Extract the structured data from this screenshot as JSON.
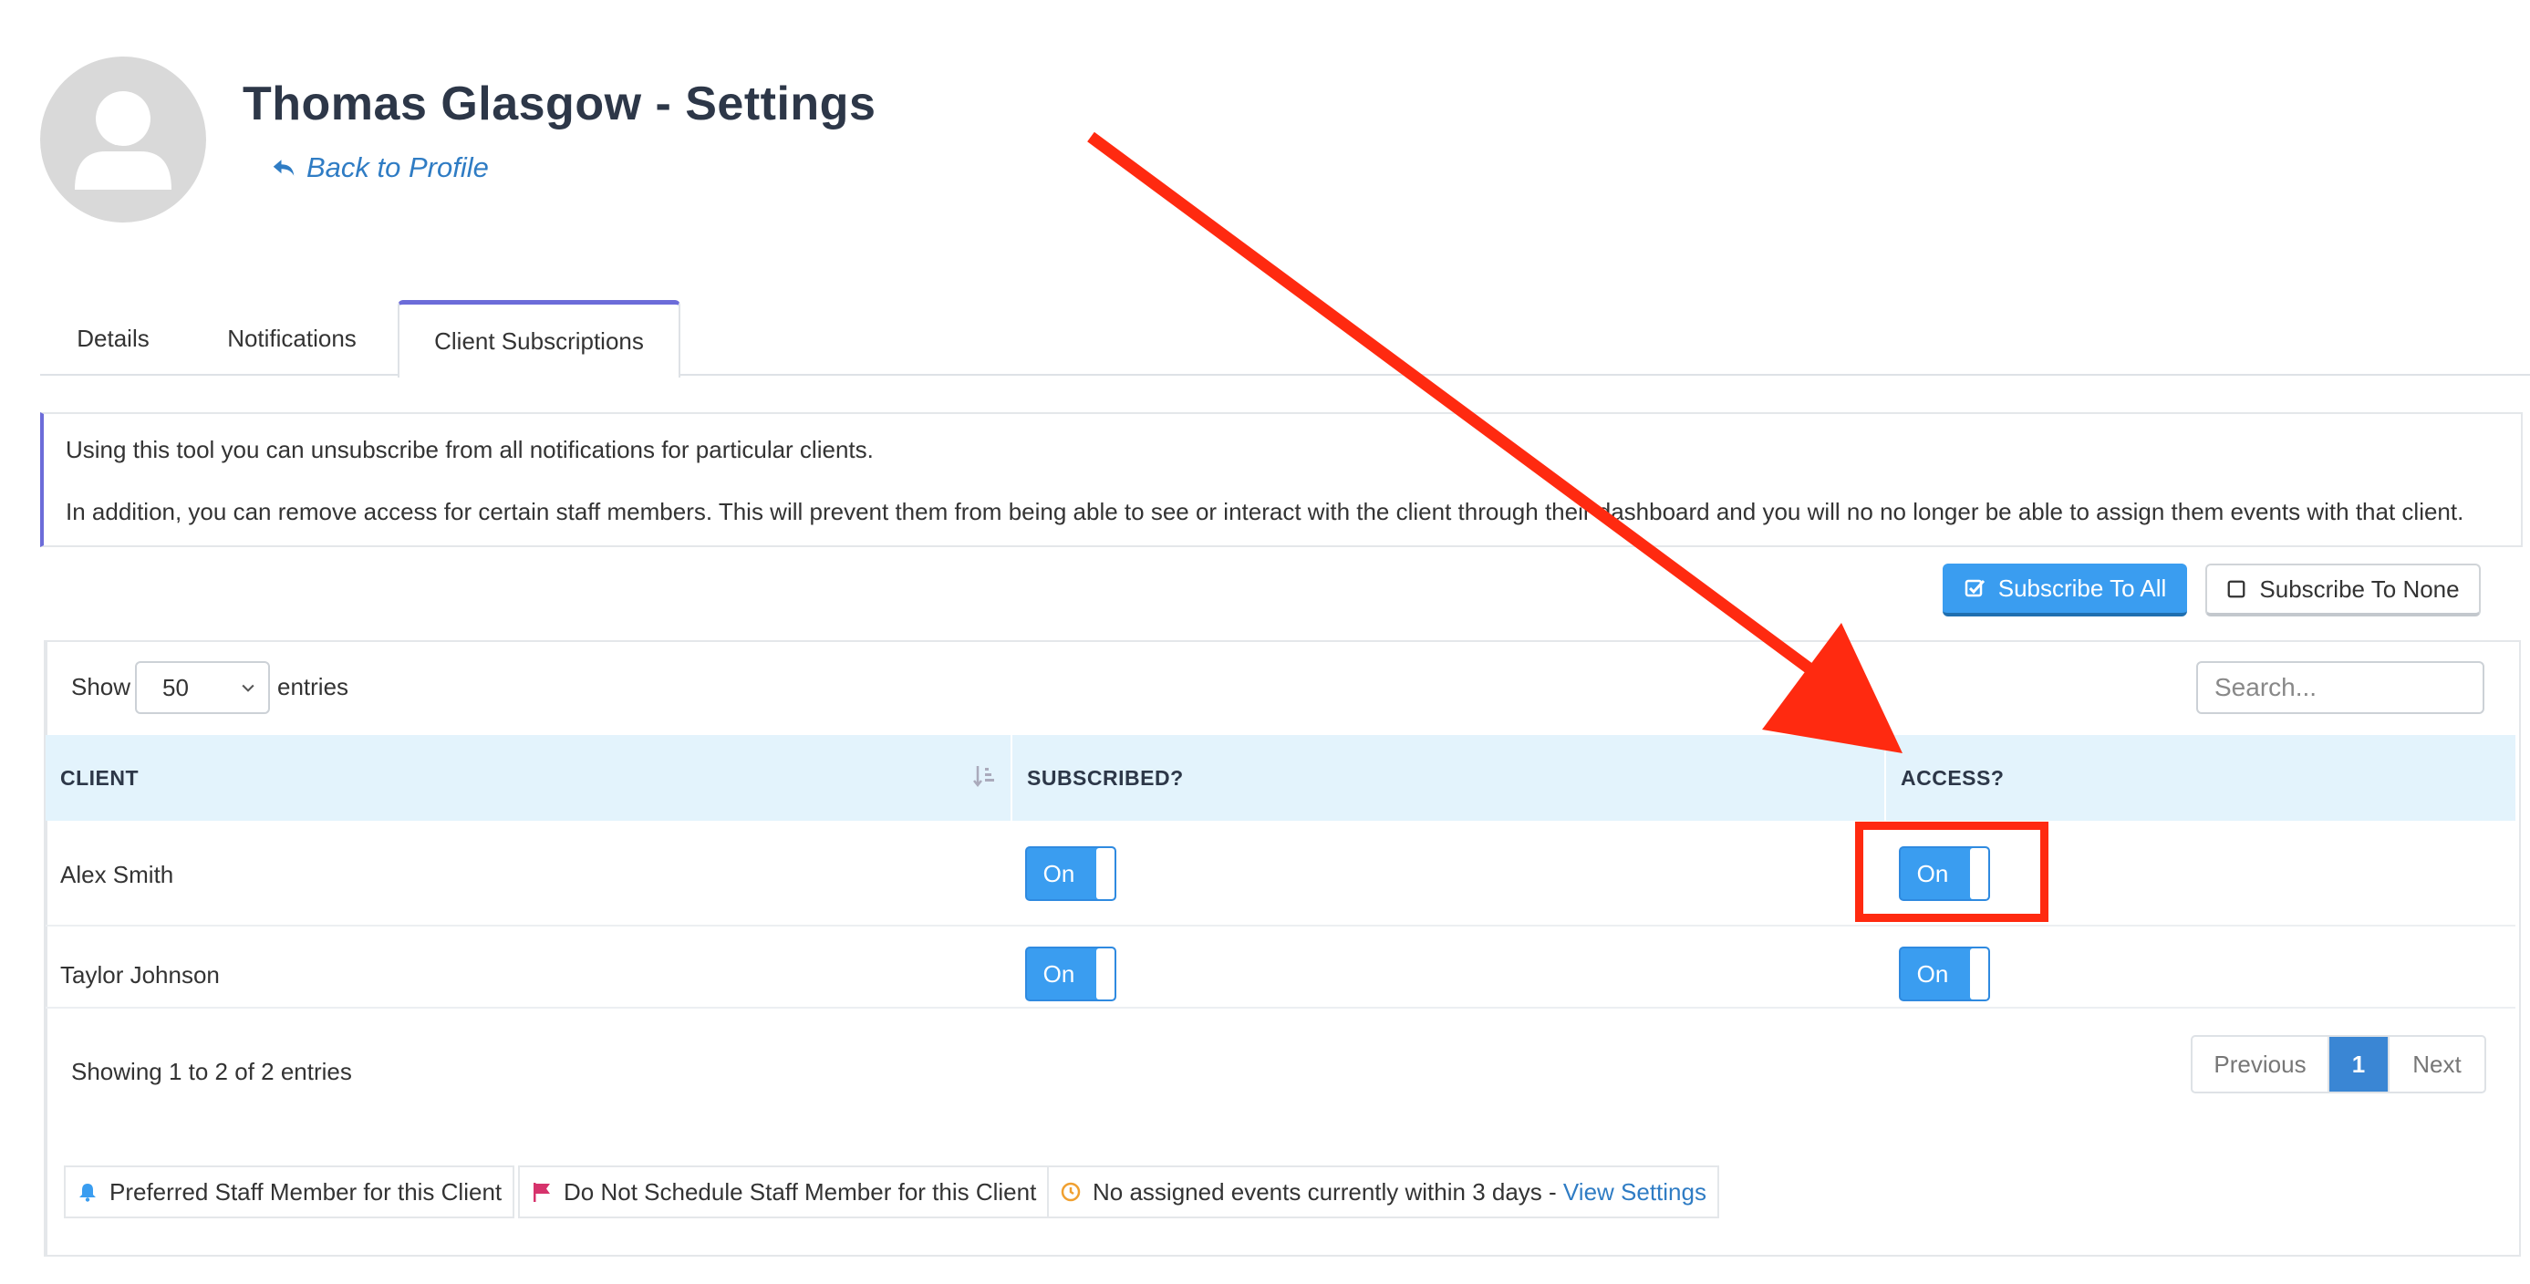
{
  "header": {
    "title": "Thomas Glasgow - Settings",
    "back_link": "Back to Profile"
  },
  "tabs": [
    {
      "label": "Details",
      "active": false
    },
    {
      "label": "Notifications",
      "active": false
    },
    {
      "label": "Client Subscriptions",
      "active": true
    }
  ],
  "info": {
    "line1": "Using this tool you can unsubscribe from all notifications for particular clients.",
    "line2": "In addition, you can remove access for certain staff members. This will prevent them from being able to see or interact with the client through their dashboard and you will no no longer be able to assign them events with that client."
  },
  "actions": {
    "subscribe_all": "Subscribe To All",
    "subscribe_none": "Subscribe To None"
  },
  "table_controls": {
    "show_label": "Show",
    "page_size": "50",
    "entries_label": "entries",
    "search_placeholder": "Search..."
  },
  "table": {
    "columns": [
      "CLIENT",
      "SUBSCRIBED?",
      "ACCESS?"
    ],
    "rows": [
      {
        "client": "Alex Smith",
        "subscribed": "On",
        "access": "On"
      },
      {
        "client": "Taylor Johnson",
        "subscribed": "On",
        "access": "On"
      }
    ]
  },
  "footer": {
    "showing": "Showing 1 to 2 of 2 entries",
    "prev": "Previous",
    "page": "1",
    "next": "Next"
  },
  "legend": {
    "preferred": "Preferred Staff Member for this Client",
    "do_not_schedule": "Do Not Schedule Staff Member for this Client",
    "no_events": "No assigned events currently within 3 days - ",
    "view_settings": "View Settings"
  },
  "colors": {
    "accent": "#3a9df0",
    "tab_accent": "#6c6cd9",
    "annotation": "#ff2a10",
    "flag": "#d6336c",
    "clock": "#f0a030"
  }
}
